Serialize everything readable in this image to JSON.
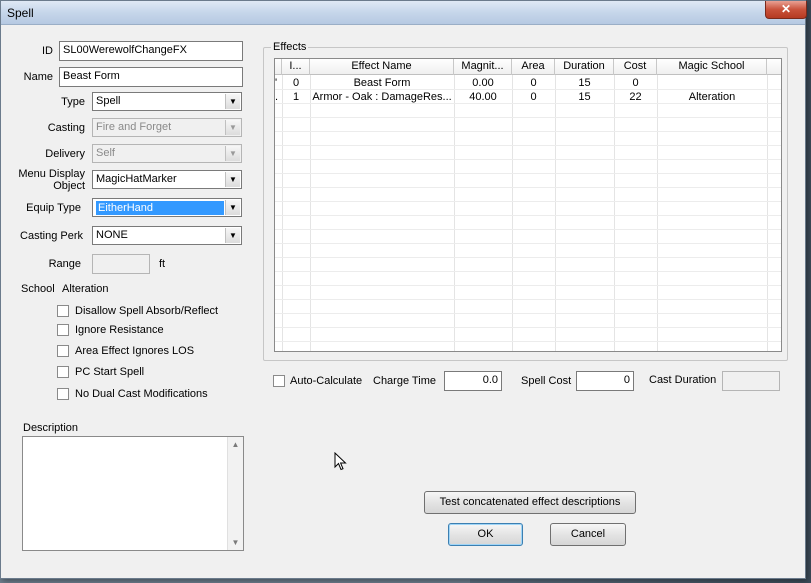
{
  "window": {
    "title": "Spell",
    "close_label": "✕"
  },
  "form": {
    "id_label": "ID",
    "id_value": "SL00WerewolfChangeFX",
    "name_label": "Name",
    "name_value": "Beast Form",
    "type_label": "Type",
    "type_value": "Spell",
    "casting_label": "Casting",
    "casting_value": "Fire and Forget",
    "delivery_label": "Delivery",
    "delivery_value": "Self",
    "menu_display_label_1": "Menu Display",
    "menu_display_label_2": "Object",
    "menu_display_value": "MagicHatMarker",
    "equip_type_label": "Equip Type",
    "equip_type_value": "EitherHand",
    "casting_perk_label": "Casting Perk",
    "casting_perk_value": "NONE",
    "range_label": "Range",
    "range_unit": "ft",
    "school_label": "School",
    "school_value": "Alteration"
  },
  "checkboxes": [
    {
      "label": "Disallow Spell Absorb/Reflect",
      "checked": false
    },
    {
      "label": "Ignore Resistance",
      "checked": false
    },
    {
      "label": "Area Effect Ignores LOS",
      "checked": false
    },
    {
      "label": "PC Start Spell",
      "checked": false
    },
    {
      "label": "No Dual Cast Modifications",
      "checked": false
    }
  ],
  "description_label": "Description",
  "effects": {
    "group_title": "Effects",
    "columns": [
      "I...",
      "Effect Name",
      "Magnit...",
      "Area",
      "Duration",
      "Cost",
      "Magic School"
    ],
    "rows": [
      {
        "marker": "'",
        "index": "0",
        "name": "Beast Form",
        "magnitude": "0.00",
        "area": "0",
        "duration": "15",
        "cost": "0",
        "school": ""
      },
      {
        "marker": ".",
        "index": "1",
        "name": "Armor - Oak : DamageRes...",
        "magnitude": "40.00",
        "area": "0",
        "duration": "15",
        "cost": "22",
        "school": "Alteration"
      }
    ]
  },
  "cost_row": {
    "auto_calculate_label": "Auto-Calculate",
    "charge_time_label": "Charge Time",
    "charge_time_value": "0.0",
    "spell_cost_label": "Spell Cost",
    "spell_cost_value": "0",
    "cast_duration_label": "Cast Duration"
  },
  "buttons": {
    "test_label": "Test concatenated effect descriptions",
    "ok_label": "OK",
    "cancel_label": "Cancel"
  },
  "colors": {
    "selection": "#3399ff",
    "titlebar": "#c6d6ea",
    "close": "#c9523b"
  }
}
